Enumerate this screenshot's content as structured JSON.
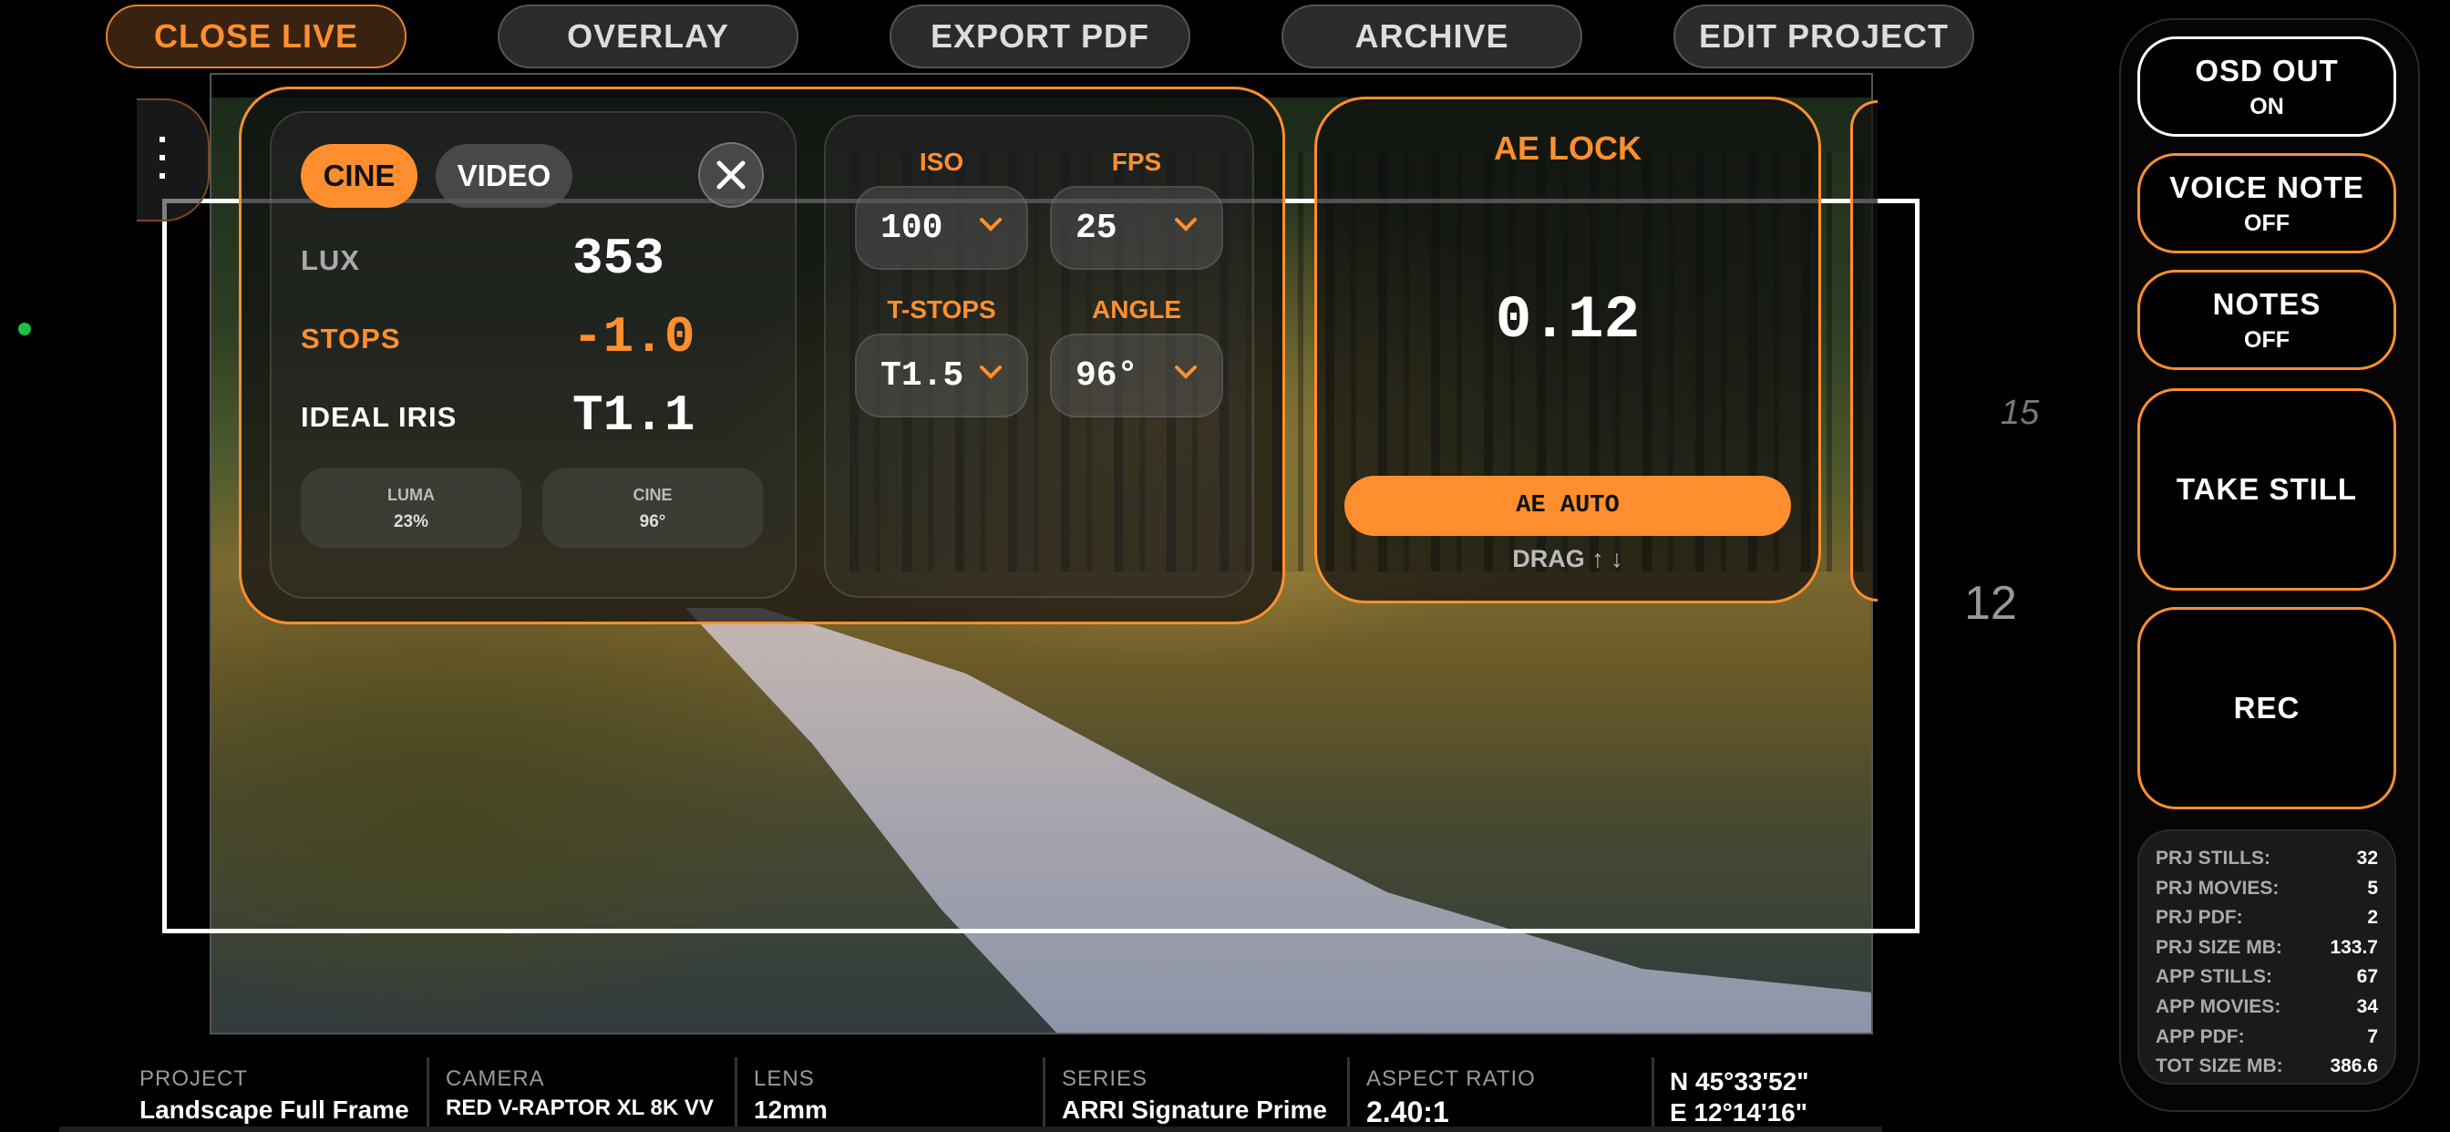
{
  "top_tabs": [
    {
      "label": "CLOSE LIVE",
      "active": true
    },
    {
      "label": "OVERLAY",
      "active": false
    },
    {
      "label": "EXPORT PDF",
      "active": false
    },
    {
      "label": "ARCHIVE",
      "active": false
    },
    {
      "label": "EDIT PROJECT",
      "active": false
    }
  ],
  "meter": {
    "mode_cine": "CINE",
    "mode_video": "VIDEO",
    "lux_label": "LUX",
    "lux_value": "353",
    "stops_label": "STOPS",
    "stops_value": "-1.0",
    "iris_label": "IDEAL IRIS",
    "iris_value": "T1.1",
    "luma_label": "LUMA",
    "luma_value": "23%",
    "cine_label": "CINE",
    "cine_value": "96°"
  },
  "exposure": {
    "iso_label": "ISO",
    "iso_value": "100",
    "fps_label": "FPS",
    "fps_value": "25",
    "tstops_label": "T-STOPS",
    "tstops_value": "T1.5",
    "angle_label": "ANGLE",
    "angle_value": "96°"
  },
  "ae": {
    "title": "AE LOCK",
    "value": "0.12",
    "button": "AE AUTO",
    "drag": "DRAG ↑ ↓"
  },
  "scale": {
    "mark_15": "15",
    "mark_12": "12"
  },
  "sidebar": {
    "osd_out": {
      "label": "OSD OUT",
      "state": "ON"
    },
    "voice_note": {
      "label": "VOICE NOTE",
      "state": "OFF"
    },
    "notes": {
      "label": "NOTES",
      "state": "OFF"
    },
    "take_still": "TAKE STILL",
    "rec": "REC"
  },
  "stats": [
    {
      "k": "PRJ STILLS:",
      "v": "32"
    },
    {
      "k": "PRJ MOVIES:",
      "v": "5"
    },
    {
      "k": "PRJ PDF:",
      "v": "2"
    },
    {
      "k": "PRJ SIZE MB:",
      "v": "133.7"
    },
    {
      "k": "APP STILLS:",
      "v": "67"
    },
    {
      "k": "APP MOVIES:",
      "v": "34"
    },
    {
      "k": "APP PDF:",
      "v": "7"
    },
    {
      "k": "TOT SIZE MB:",
      "v": "386.6"
    }
  ],
  "info_bar": {
    "project": {
      "k": "PROJECT",
      "v": "Landscape Full Frame"
    },
    "camera": {
      "k": "CAMERA",
      "v": "RED V-RAPTOR XL 8K VV"
    },
    "lens": {
      "k": "LENS",
      "v": "12mm"
    },
    "series": {
      "k": "SERIES",
      "v": "ARRI Signature Prime"
    },
    "aspect": {
      "k": "ASPECT RATIO",
      "v": "2.40:1"
    },
    "gps_n": "N 45°33'52\"",
    "gps_e": "E 12°14'16\""
  },
  "colors": {
    "accent": "#ff8f2e",
    "rec_dot": "#1fbf4a"
  }
}
